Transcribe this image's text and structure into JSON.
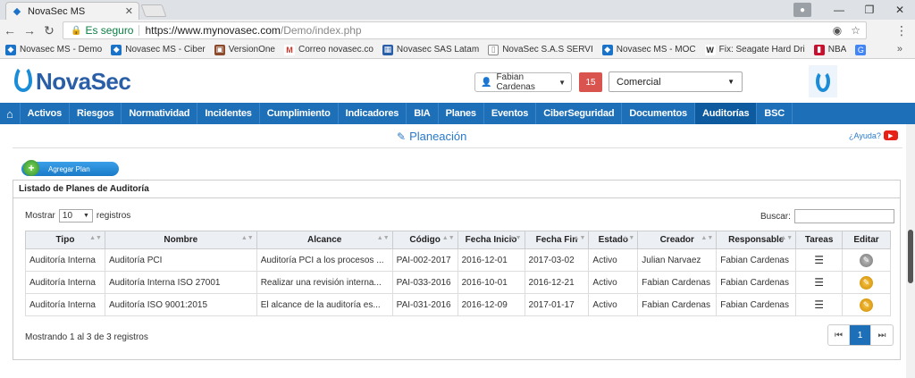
{
  "browser": {
    "tab_title": "NovaSec MS",
    "secure_label": "Es seguro",
    "url_base": "https://www.mynovasec.com",
    "url_path": "/Demo/index.php"
  },
  "bookmarks": [
    {
      "label": "Novasec MS - Demo",
      "icon_color": "#1a73c8"
    },
    {
      "label": "Novasec MS - Ciber",
      "icon_color": "#1a73c8"
    },
    {
      "label": "VersionOne",
      "icon_color": "#8b4a2b"
    },
    {
      "label": "Correo novasec.co",
      "icon_color": "#d93025"
    },
    {
      "label": "Novasec SAS Latam",
      "icon_color": "#2a5fa8"
    },
    {
      "label": "NovaSec S.A.S SERVI",
      "icon_color": "#888888"
    },
    {
      "label": "Novasec MS - MOC",
      "icon_color": "#1a73c8"
    },
    {
      "label": "Fix: Seagate Hard Dri",
      "icon_color": "#333333"
    },
    {
      "label": "NBA",
      "icon_color": "#c8102e"
    }
  ],
  "header": {
    "logo_text": "NovaSec",
    "user_name": "Fabian Cardenas",
    "notification_count": "15",
    "module_select": "Comercial"
  },
  "nav": {
    "items": [
      "Activos",
      "Riesgos",
      "Normatividad",
      "Incidentes",
      "Cumplimiento",
      "Indicadores",
      "BIA",
      "Planes",
      "Eventos",
      "CiberSeguridad",
      "Documentos",
      "Auditorías",
      "BSC"
    ],
    "active": "Auditorías"
  },
  "page": {
    "title": "Planeación",
    "help": "¿Ayuda?",
    "add_button": "Agregar Plan"
  },
  "panel": {
    "title": "Listado de Planes de Auditoría",
    "show_label": "Mostrar",
    "show_value": "10",
    "records_label": "registros",
    "search_label": "Buscar:",
    "footer": "Mostrando 1 al 3 de 3 registros",
    "current_page": "1"
  },
  "table": {
    "columns": [
      "Tipo",
      "Nombre",
      "Alcance",
      "Código",
      "Fecha Inicio",
      "Fecha Fin",
      "Estado",
      "Creador",
      "Responsable",
      "Tareas",
      "Editar"
    ],
    "rows": [
      {
        "tipo": "Auditoría Interna",
        "nombre": "Auditoría PCI",
        "alcance": "Auditoría PCI a los procesos ...",
        "codigo": "PAI-002-2017",
        "inicio": "2016-12-01",
        "fin": "2017-03-02",
        "estado": "Activo",
        "creador": "Julian Narvaez",
        "responsable": "Fabian Cardenas",
        "edit": "gray"
      },
      {
        "tipo": "Auditoría Interna",
        "nombre": "Auditoría Interna ISO 27001",
        "alcance": "Realizar una revisión interna...",
        "codigo": "PAI-033-2016",
        "inicio": "2016-10-01",
        "fin": "2016-12-21",
        "estado": "Activo",
        "creador": "Fabian Cardenas",
        "responsable": "Fabian Cardenas",
        "edit": "gold"
      },
      {
        "tipo": "Auditoría Interna",
        "nombre": "Auditoría ISO 9001:2015",
        "alcance": "El alcance de la auditoría es...",
        "codigo": "PAI-031-2016",
        "inicio": "2016-12-09",
        "fin": "2017-01-17",
        "estado": "Activo",
        "creador": "Fabian Cardenas",
        "responsable": "Fabian Cardenas",
        "edit": "gold"
      }
    ]
  }
}
